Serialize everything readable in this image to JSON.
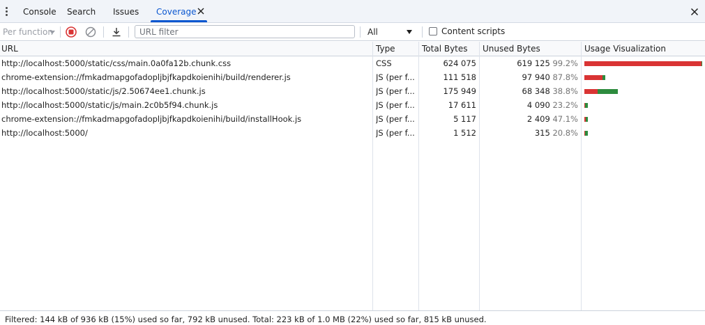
{
  "tabs": [
    {
      "label": "Console",
      "active": false
    },
    {
      "label": "Search",
      "active": false
    },
    {
      "label": "Issues",
      "active": false
    },
    {
      "label": "Coverage",
      "active": true
    }
  ],
  "toolbar": {
    "per_function_label": "Per function",
    "url_filter_placeholder": "URL filter",
    "url_filter_value": "",
    "type_filter_value": "All",
    "content_scripts_label": "Content scripts",
    "content_scripts_checked": false
  },
  "table": {
    "columns": [
      "URL",
      "Type",
      "Total Bytes",
      "Unused Bytes",
      "Usage Visualization"
    ],
    "rows": [
      {
        "url": "http://localhost:5000/static/css/main.0a0fa12b.chunk.css",
        "type": "CSS",
        "total": "624 075",
        "unused": "619 125",
        "pct": "99.2%",
        "total_bytes": 624075,
        "unused_bytes": 619125
      },
      {
        "url": "chrome-extension://fmkadmapgofadopljbjfkapdkoienihi/build/renderer.js",
        "type": "JS (per f...",
        "total": "111 518",
        "unused": "97 940",
        "pct": "87.8%",
        "total_bytes": 111518,
        "unused_bytes": 97940
      },
      {
        "url": "http://localhost:5000/static/js/2.50674ee1.chunk.js",
        "type": "JS (per f...",
        "total": "175 949",
        "unused": "68 348",
        "pct": "38.8%",
        "total_bytes": 175949,
        "unused_bytes": 68348
      },
      {
        "url": "http://localhost:5000/static/js/main.2c0b5f94.chunk.js",
        "type": "JS (per f...",
        "total": "17 611",
        "unused": "4 090",
        "pct": "23.2%",
        "total_bytes": 17611,
        "unused_bytes": 4090
      },
      {
        "url": "chrome-extension://fmkadmapgofadopljbjfkapdkoienihi/build/installHook.js",
        "type": "JS (per f...",
        "total": "5 117",
        "unused": "2 409",
        "pct": "47.1%",
        "total_bytes": 5117,
        "unused_bytes": 2409
      },
      {
        "url": "http://localhost:5000/",
        "type": "JS (per f...",
        "total": "1 512",
        "unused": "315",
        "pct": "20.8%",
        "total_bytes": 1512,
        "unused_bytes": 315
      }
    ]
  },
  "status": {
    "text": "Filtered: 144 kB of 936 kB (15%) used so far, 792 kB unused. Total: 223 kB of 1.0 MB (22%) used so far, 815 kB unused."
  },
  "colors": {
    "accent": "#0b57d0",
    "unused_bar": "#d93434",
    "used_bar": "#2d8b3e",
    "record_stop": "#d93434"
  },
  "icons": [
    "more-vert-icon",
    "close-icon",
    "record-stop-icon",
    "clear-icon",
    "download-icon",
    "dropdown-caret-icon"
  ]
}
